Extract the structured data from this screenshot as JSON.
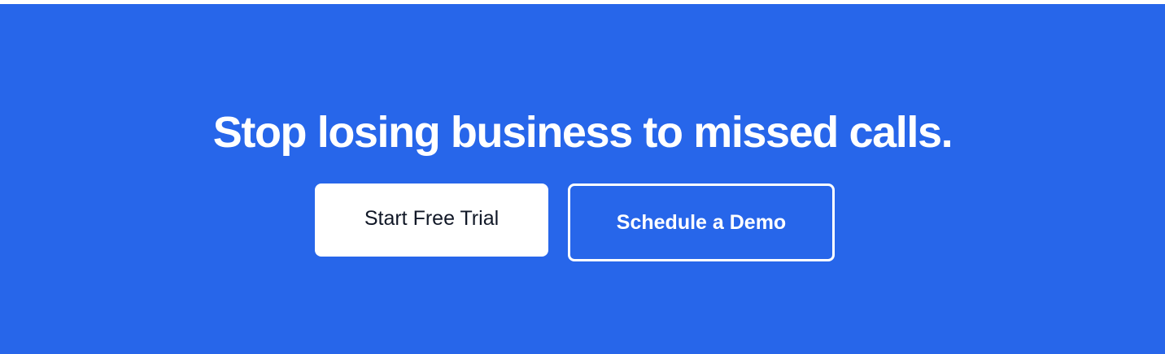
{
  "cta": {
    "headline": "Stop losing business to missed calls.",
    "primary_label": "Start Free Trial",
    "secondary_label": "Schedule a Demo"
  },
  "colors": {
    "banner_background": "#2766EA",
    "primary_button_background": "#FFFFFF",
    "primary_button_text": "#111827",
    "secondary_button_border": "#FFFFFF",
    "secondary_button_text": "#FFFFFF"
  }
}
